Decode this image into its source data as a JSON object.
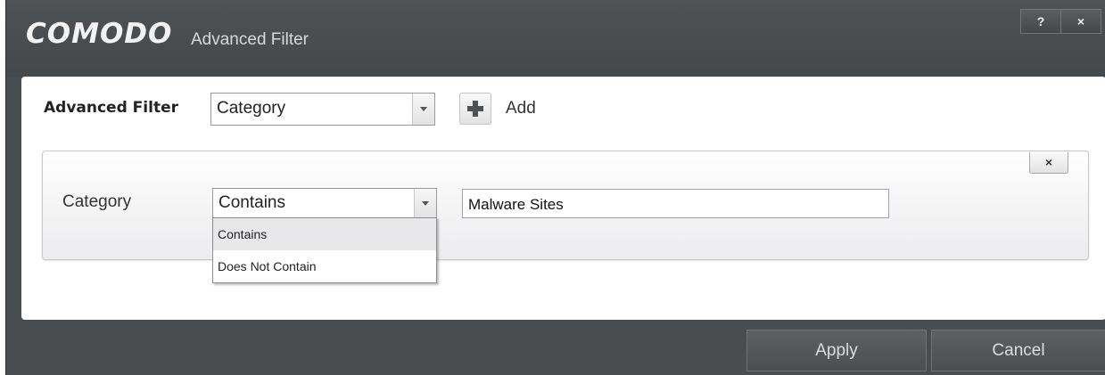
{
  "window": {
    "brand": "COMODO",
    "title": "Advanced Filter",
    "help_label": "?",
    "close_label": "×"
  },
  "filter_bar": {
    "label": "Advanced Filter",
    "selected": "Category",
    "add_label": "Add"
  },
  "condition": {
    "remove_label": "×",
    "field_label": "Category",
    "operator": {
      "selected": "Contains",
      "options": [
        "Contains",
        "Does Not Contain"
      ]
    },
    "value": "Malware Sites"
  },
  "footer": {
    "apply_label": "Apply",
    "cancel_label": "Cancel"
  }
}
